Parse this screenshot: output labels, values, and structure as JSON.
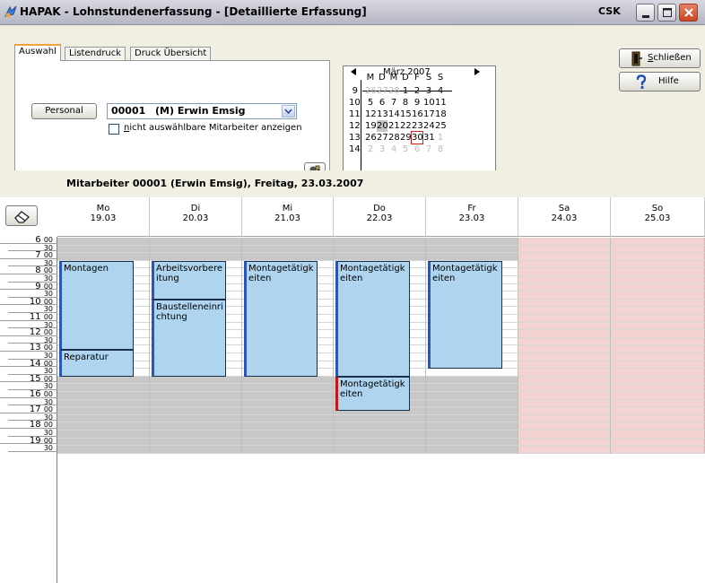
{
  "window": {
    "title": "HAPAK - Lohnstundenerfassung - [Detaillierte Erfassung]",
    "user": "CSK",
    "icon": "hapak-app-icon"
  },
  "tabs": [
    {
      "label": "Auswahl",
      "active": true
    },
    {
      "label": "Listendruck",
      "active": false
    },
    {
      "label": "Druck Übersicht",
      "active": false
    }
  ],
  "selection": {
    "personal_button": "Personal",
    "employee_code": "00001",
    "employee_name": "(M) Erwin Emsig",
    "checkbox_checked": false,
    "checkbox_label_accel": "n",
    "checkbox_label_rest": "icht auswählbare Mitarbeiter anzeigen",
    "tool_icon": "user-settings-icon"
  },
  "calendar": {
    "month_label": "März 2007",
    "weekday_headers": [
      "M",
      "D",
      "M",
      "D",
      "F",
      "S",
      "S"
    ],
    "weeks": [
      {
        "num": "9",
        "days": [
          "26",
          "27",
          "28",
          "1",
          "2",
          "3",
          "4"
        ],
        "outside": [
          true,
          true,
          true,
          false,
          false,
          false,
          false
        ]
      },
      {
        "num": "10",
        "days": [
          "5",
          "6",
          "7",
          "8",
          "9",
          "10",
          "11"
        ],
        "outside": [
          false,
          false,
          false,
          false,
          false,
          false,
          false
        ]
      },
      {
        "num": "11",
        "days": [
          "12",
          "13",
          "14",
          "15",
          "16",
          "17",
          "18"
        ],
        "outside": [
          false,
          false,
          false,
          false,
          false,
          false,
          false
        ]
      },
      {
        "num": "12",
        "days": [
          "19",
          "20",
          "21",
          "22",
          "23",
          "24",
          "25"
        ],
        "outside": [
          false,
          false,
          false,
          false,
          false,
          false,
          false
        ]
      },
      {
        "num": "13",
        "days": [
          "26",
          "27",
          "28",
          "29",
          "30",
          "31",
          "1"
        ],
        "outside": [
          false,
          false,
          false,
          false,
          false,
          false,
          true
        ]
      },
      {
        "num": "14",
        "days": [
          "2",
          "3",
          "4",
          "5",
          "6",
          "7",
          "8"
        ],
        "outside": [
          true,
          true,
          true,
          true,
          true,
          true,
          true
        ]
      }
    ],
    "selected_day": "20",
    "today_day": "30",
    "outside_color": "#bcbcbc",
    "selected_color": "#c6c6c6",
    "today_border_color": "#d02020"
  },
  "buttons": {
    "close_accel": "S",
    "close_rest": "chließen",
    "close_icon": "door-exit-icon",
    "help_label": "Hilfe",
    "help_icon": "question-mark-icon"
  },
  "schedule": {
    "title": "Mitarbeiter 00001 (Erwin Emsig), Freitag, 23.03.2007",
    "eraser_icon": "eraser-icon",
    "days": [
      {
        "name": "Mo",
        "date": "19.03",
        "weekend": false
      },
      {
        "name": "Di",
        "date": "20.03",
        "weekend": false
      },
      {
        "name": "Mi",
        "date": "21.03",
        "weekend": false
      },
      {
        "name": "Do",
        "date": "22.03",
        "weekend": false
      },
      {
        "name": "Fr",
        "date": "23.03",
        "weekend": false
      },
      {
        "name": "Sa",
        "date": "24.03",
        "weekend": true
      },
      {
        "name": "So",
        "date": "25.03",
        "weekend": true
      }
    ],
    "time_labels": [
      {
        "hour": "6",
        "min": "00"
      },
      {
        "min": "30"
      },
      {
        "hour": "7",
        "min": "00"
      },
      {
        "min": "30"
      },
      {
        "hour": "8",
        "min": "00"
      },
      {
        "min": "30"
      },
      {
        "hour": "9",
        "min": "00"
      },
      {
        "min": "30"
      },
      {
        "hour": "10",
        "min": "00"
      },
      {
        "min": "30"
      },
      {
        "hour": "11",
        "min": "00"
      },
      {
        "min": "30"
      },
      {
        "hour": "12",
        "min": "00"
      },
      {
        "min": "30"
      },
      {
        "hour": "13",
        "min": "00"
      },
      {
        "min": "30"
      },
      {
        "hour": "14",
        "min": "00"
      },
      {
        "min": "30"
      },
      {
        "hour": "15",
        "min": "00"
      },
      {
        "min": "30"
      },
      {
        "hour": "16",
        "min": "00"
      },
      {
        "min": "30"
      },
      {
        "hour": "17",
        "min": "00"
      },
      {
        "min": "30"
      },
      {
        "hour": "18",
        "min": "00"
      },
      {
        "min": "30"
      },
      {
        "hour": "19",
        "min": "00"
      },
      {
        "min": "30"
      }
    ],
    "working_hours": {
      "start": "07:30",
      "end": "15:00"
    },
    "colors": {
      "off_hours": "#c8c8c8",
      "working": "#ffffff",
      "weekend": "#f5d2d2",
      "event_fill": "#aed4ef",
      "event_stripe": "#2a56b8",
      "event_stripe_overtime": "#c01818"
    },
    "events": [
      {
        "day": 0,
        "start": "07:30",
        "end": "13:15",
        "label": "Montagen",
        "overtime": false
      },
      {
        "day": 0,
        "start": "13:15",
        "end": "15:00",
        "label": "Reparatur",
        "overtime": false
      },
      {
        "day": 1,
        "start": "07:30",
        "end": "10:00",
        "label": "Arbeitsvorbereitung",
        "overtime": false
      },
      {
        "day": 1,
        "start": "10:00",
        "end": "15:00",
        "label": "Baustelleneinrichtung",
        "overtime": false
      },
      {
        "day": 2,
        "start": "07:30",
        "end": "15:00",
        "label": "Montagetätigkeiten",
        "overtime": false
      },
      {
        "day": 3,
        "start": "07:30",
        "end": "15:00",
        "label": "Montagetätigkeiten",
        "overtime": false
      },
      {
        "day": 3,
        "start": "15:00",
        "end": "17:15",
        "label": "Montagetätigkeiten",
        "overtime": true
      },
      {
        "day": 4,
        "start": "07:30",
        "end": "14:30",
        "label": "Montagetätigkeiten",
        "overtime": false
      }
    ]
  }
}
